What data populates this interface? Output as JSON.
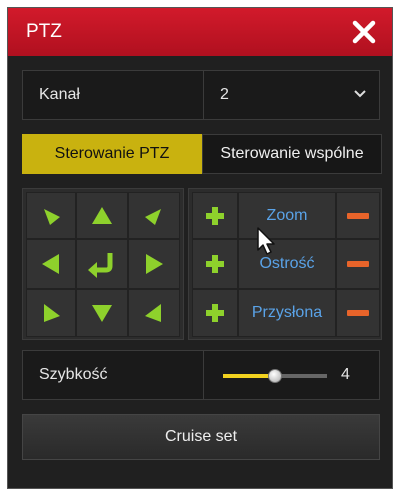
{
  "window": {
    "title": "PTZ"
  },
  "channel": {
    "label": "Kanał",
    "value": "2"
  },
  "tabs": [
    {
      "label": "Sterowanie PTZ",
      "active": true
    },
    {
      "label": "Sterowanie wspólne",
      "active": false
    }
  ],
  "lens": [
    {
      "label": "Zoom"
    },
    {
      "label": "Ostrość"
    },
    {
      "label": "Przysłona"
    }
  ],
  "speed": {
    "label": "Szybkość",
    "value": "4",
    "level": 4,
    "max": 8
  },
  "cruise": {
    "label": "Cruise set"
  },
  "colors": {
    "title_bar": "#c8102e",
    "accent": "#c9b20f",
    "arrow": "#8ed12c",
    "plus": "#8ed12c",
    "minus": "#e8642a",
    "lens_text": "#5aa3e8"
  }
}
